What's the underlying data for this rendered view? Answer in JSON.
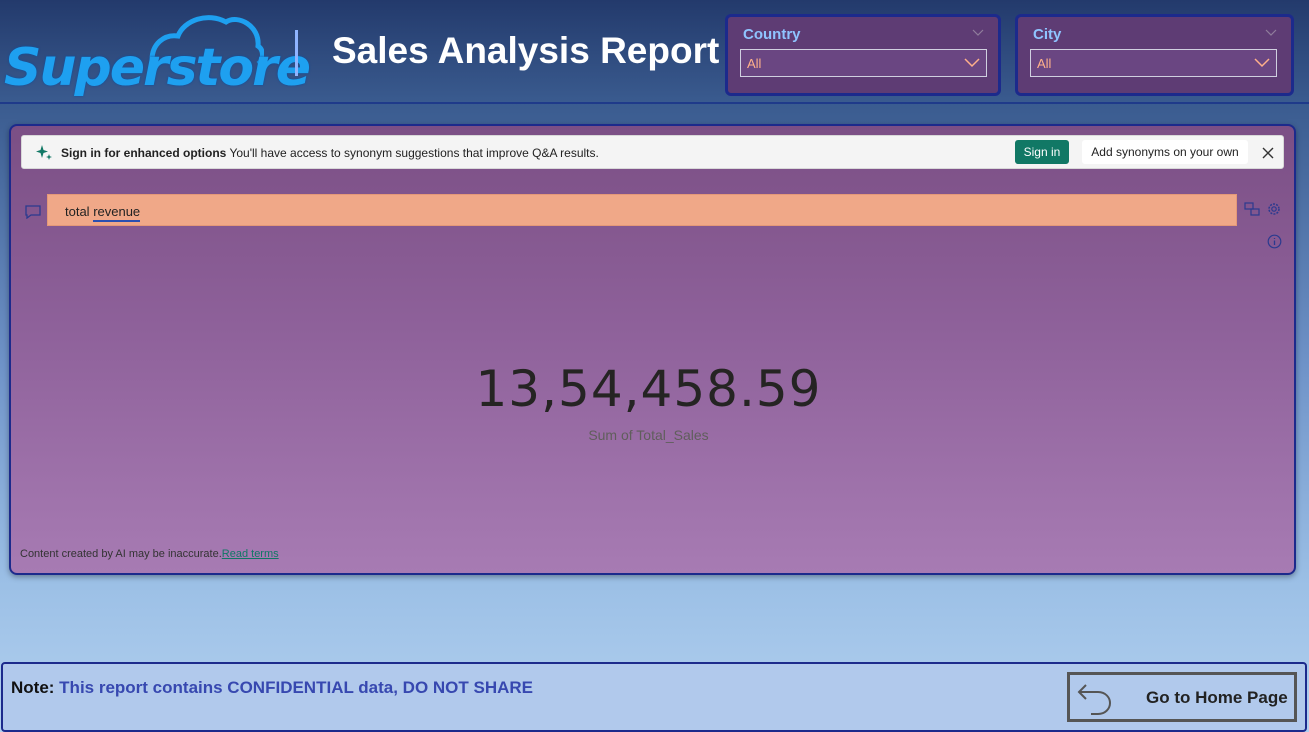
{
  "header": {
    "logo_text": "Superstore",
    "title": "Sales Analysis Report"
  },
  "slicers": {
    "country": {
      "label": "Country",
      "value": "All"
    },
    "city": {
      "label": "City",
      "value": "All"
    }
  },
  "qa": {
    "signin_bold": "Sign in for enhanced options",
    "signin_rest": " You'll have access to synonym suggestions that improve Q&A results.",
    "signin_button": "Sign in",
    "add_synonyms_button": "Add synonyms on your own",
    "query_prefix": "total ",
    "query_term": "revenue",
    "card_value": "13,54,458.59",
    "card_label": "Sum of Total_Sales",
    "disclaimer": "Content created by AI may be inaccurate.",
    "read_terms": "Read terms"
  },
  "footer": {
    "note_label": "Note:",
    "note_message": " This report contains CONFIDENTIAL data, DO NOT SHARE",
    "home_button": "Go to Home Page"
  },
  "colors": {
    "accent_teal": "#117865",
    "input_bg": "#f0a888",
    "slicer_bg": "#5e3c74",
    "note_blue": "#3748b0"
  }
}
